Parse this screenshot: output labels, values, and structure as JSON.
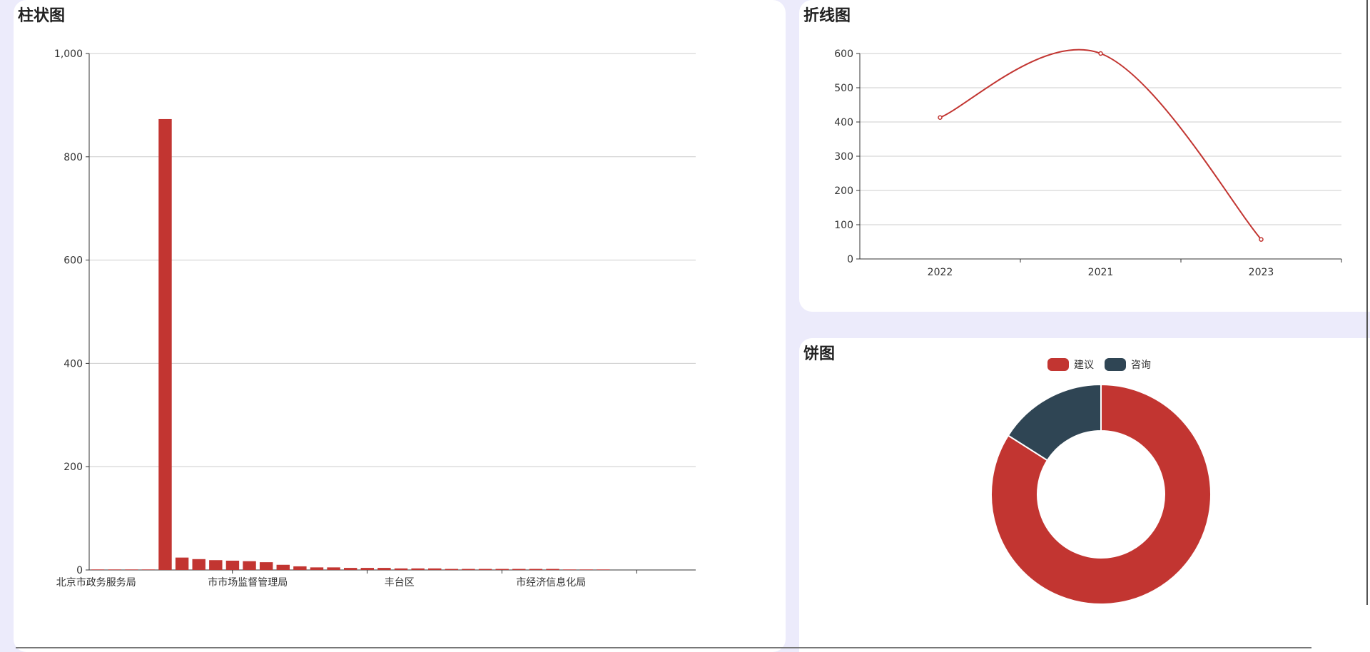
{
  "bar_panel": {
    "title": "柱状图"
  },
  "line_panel": {
    "title": "折线图"
  },
  "pie_panel": {
    "title": "饼图"
  },
  "colors": {
    "red": "#c23531",
    "navy": "#2f4554",
    "grid": "#cccccc",
    "axis": "#333333"
  },
  "chart_data": [
    {
      "type": "bar",
      "title": "",
      "xlabel": "",
      "ylabel": "",
      "ylim": [
        0,
        1000
      ],
      "yticks": [
        "0",
        "200",
        "400",
        "600",
        "800",
        "1,000"
      ],
      "categories": [
        "北京市政务服务局",
        "",
        "",
        "",
        "",
        "",
        "",
        "",
        "",
        "市市场监督管理局",
        "",
        "",
        "",
        "",
        "",
        "",
        "",
        "",
        "丰台区",
        "",
        "",
        "",
        "",
        "",
        "",
        "",
        "",
        "市经济信息化局",
        "",
        "",
        "",
        "",
        "",
        "",
        ""
      ],
      "values": [
        1,
        1,
        1,
        1,
        873,
        24,
        21,
        19,
        18,
        17,
        15,
        10,
        7,
        5,
        5,
        4,
        4,
        4,
        3,
        3,
        3,
        2,
        2,
        2,
        2,
        2,
        2,
        2,
        1,
        1,
        1
      ],
      "visible_x_labels": [
        "北京市政务服务局",
        "市市场监督管理局",
        "丰台区",
        "市经济信息化局"
      ],
      "grid": true
    },
    {
      "type": "line",
      "title": "",
      "xlabel": "",
      "ylabel": "",
      "categories": [
        "2022",
        "2021",
        "2023"
      ],
      "values": [
        413,
        600,
        57
      ],
      "ylim": [
        0,
        600
      ],
      "yticks": [
        "0",
        "100",
        "200",
        "300",
        "400",
        "500",
        "600"
      ],
      "smooth": true,
      "grid": true
    },
    {
      "type": "pie",
      "title": "",
      "legend_position": "top-center",
      "donut": true,
      "slices": [
        {
          "name": "建议",
          "value": 84
        },
        {
          "name": "咨询",
          "value": 16
        }
      ]
    }
  ]
}
